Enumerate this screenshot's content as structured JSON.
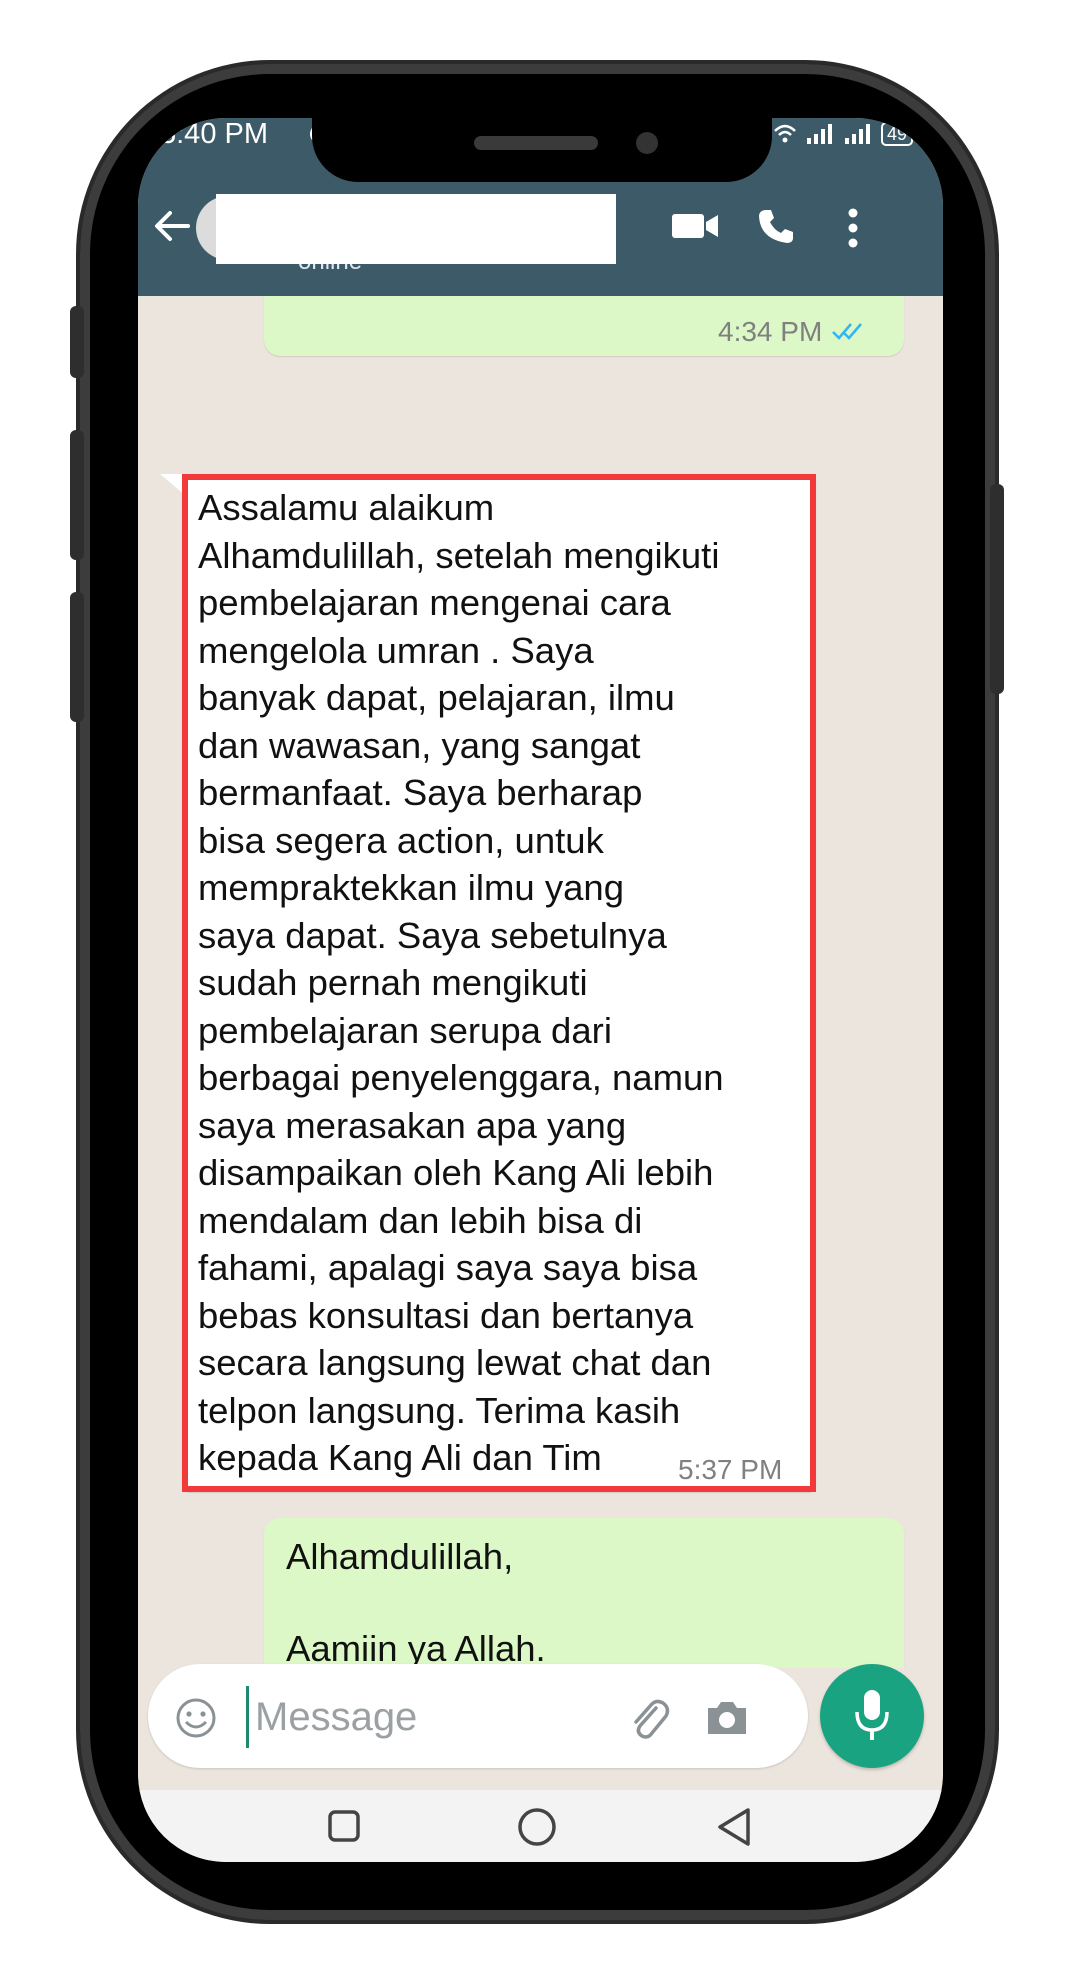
{
  "status_bar": {
    "time": "5:40 PM",
    "battery": "49"
  },
  "chat_header": {
    "contact_status": "online"
  },
  "messages": {
    "prev_outgoing_time": "4:34 PM",
    "incoming_text": "Assalamu alaikum\nAlhamdulillah, setelah mengikuti\npembelajaran mengenai cara\nmengelola umran              . Saya\nbanyak dapat, pelajaran, ilmu\ndan wawasan, yang sangat\nbermanfaat. Saya berharap\nbisa segera action, untuk\nmempraktekkan ilmu yang\nsaya dapat. Saya sebetulnya\nsudah pernah mengikuti\npembelajaran serupa dari\nberbagai penyelenggara, namun\nsaya merasakan apa yang\ndisampaikan oleh Kang Ali lebih\nmendalam dan lebih bisa di\nfahami, apalagi saya saya bisa\nbebas konsultasi dan bertanya\nsecara langsung lewat chat dan\ntelpon langsung. Terima kasih\nkepada Kang Ali dan Tim",
    "incoming_time": "5:37 PM",
    "outgoing_text": "Alhamdulillah,\n\nAamiin ya Allah.\n\nTerima kasih banyak Pak atas"
  },
  "composer": {
    "placeholder": "Message"
  },
  "colors": {
    "header": "#3c5a67",
    "outgoing_bubble": "#dcf8c6",
    "chat_bg": "#ece5dd",
    "mic_button": "#1aa380",
    "highlight_border": "#f23a3a"
  }
}
